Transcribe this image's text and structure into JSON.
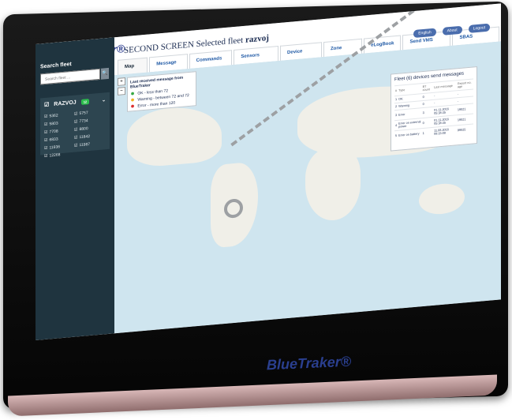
{
  "app": {
    "logo": "BlueTraker®",
    "screen_title": "SECOND SCREEN Selected fleet",
    "screen_title_fleet": "razvoj"
  },
  "tabs": [
    {
      "label": "Map view"
    },
    {
      "label": "Message view"
    },
    {
      "label": "Commands send"
    },
    {
      "label": "Sensors message"
    },
    {
      "label": "Device manager"
    },
    {
      "label": "Zone manager"
    },
    {
      "label": "eLogBook"
    },
    {
      "label": "Send VMS message"
    },
    {
      "label": "SBAS Configurator"
    }
  ],
  "top_links": {
    "english": "English",
    "about": "About",
    "logout": "Logout"
  },
  "sidebar": {
    "title": "Search fleet",
    "search_placeholder": "Search fleet ...",
    "search_button": "🔍",
    "fleet_name": "RAZVOJ",
    "fleet_count": "12",
    "devices": [
      "5362",
      "5757",
      "5803",
      "7734",
      "7708",
      "8800",
      "6833",
      "11842",
      "11936",
      "11987",
      "12268"
    ]
  },
  "map_controls": {
    "zoom_in": "+",
    "zoom_out": "−"
  },
  "legend": {
    "title": "Last received message from BlueTraker",
    "items": [
      {
        "icon": "⬢",
        "text": "OK - less than 72"
      },
      {
        "icon": "⬢",
        "text": "Warning - between 72 and 72"
      },
      {
        "icon": "⬢",
        "text": "Error - more than 120"
      }
    ]
  },
  "messages_panel": {
    "title": "Fleet (6) devices send messages",
    "columns": [
      "#",
      "Type",
      "BT count",
      "Last message",
      "Report no. age"
    ],
    "rows": [
      {
        "num": "1",
        "type": "OK",
        "count": "0",
        "last": "-",
        "age": "-"
      },
      {
        "num": "2",
        "type": "Warning",
        "count": "0",
        "last": "-",
        "age": "-"
      },
      {
        "num": "3",
        "type": "Error",
        "count": "3",
        "last": "01.11.2016 05:38:35",
        "age": "19021"
      },
      {
        "num": "4",
        "type": "Error on external power",
        "count": "0",
        "last": "01.11.2016 05:38:35",
        "age": "19021"
      },
      {
        "num": "5",
        "type": "Error on battery",
        "count": "1",
        "last": "11.08.2016 08:15:08",
        "age": "99025"
      }
    ]
  },
  "bottom_logo": "BlueTraker®"
}
